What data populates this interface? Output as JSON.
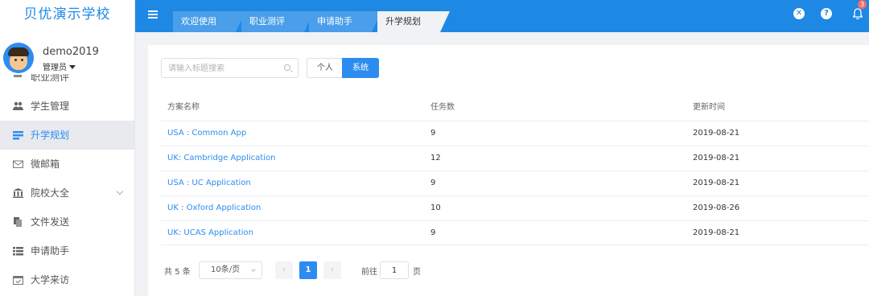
{
  "sidebar": {
    "brand": "贝优演示学校",
    "user": {
      "name": "demo2019",
      "role": "管理员"
    },
    "cut_item": "职业测评",
    "items": [
      {
        "label": "学生管理",
        "icon": "users-icon",
        "active": false
      },
      {
        "label": "升学规划",
        "icon": "plan-icon",
        "active": true
      },
      {
        "label": "微邮箱",
        "icon": "mail-icon",
        "active": false
      },
      {
        "label": "院校大全",
        "icon": "bank-icon",
        "active": false,
        "expandable": true
      },
      {
        "label": "文件发送",
        "icon": "file-icon",
        "active": false
      },
      {
        "label": "申请助手",
        "icon": "list-icon",
        "active": false
      },
      {
        "label": "大学来访",
        "icon": "calendar-icon",
        "active": false
      }
    ]
  },
  "topbar": {
    "tabs": [
      "欢迎使用",
      "职业测评",
      "申请助手",
      "升学规划"
    ],
    "active_tab": 3,
    "notification_count": "3",
    "colors": {
      "bar": "#1e88e5",
      "accent": "#2d8cf0"
    }
  },
  "main": {
    "search_placeholder": "请输入标题搜索",
    "filter": {
      "personal": "个人",
      "system": "系统",
      "selected": "系统"
    },
    "table": {
      "headers": [
        "方案名称",
        "任务数",
        "更新时间"
      ],
      "rows": [
        {
          "name": "USA : Common App",
          "tasks": "9",
          "updated": "2019-08-21"
        },
        {
          "name": "UK: Cambridge Application",
          "tasks": "12",
          "updated": "2019-08-21"
        },
        {
          "name": "USA : UC Application",
          "tasks": "9",
          "updated": "2019-08-21"
        },
        {
          "name": "UK : Oxford Application",
          "tasks": "10",
          "updated": "2019-08-26"
        },
        {
          "name": "UK: UCAS Application",
          "tasks": "9",
          "updated": "2019-08-21"
        }
      ]
    },
    "pagination": {
      "total": "共 5 条",
      "page_size": "10条/页",
      "current_page": "1",
      "goto_label": "前往",
      "goto_value": "1",
      "page_label": "页"
    }
  }
}
